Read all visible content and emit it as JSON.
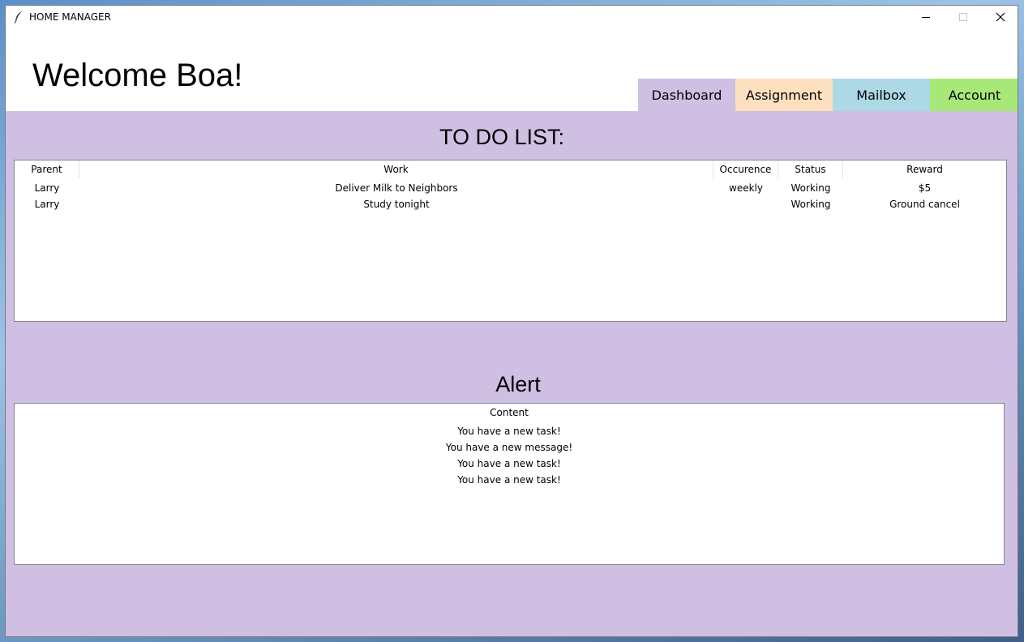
{
  "window": {
    "title": "HOME MANAGER"
  },
  "header": {
    "welcome": "Welcome Boa!"
  },
  "tabs": [
    {
      "label": "Dashboard",
      "color": "#cfbfe3"
    },
    {
      "label": "Assignment",
      "color": "#fde0c0"
    },
    {
      "label": "Mailbox",
      "color": "#add8e6"
    },
    {
      "label": "Account",
      "color": "#a8e878"
    }
  ],
  "todo": {
    "title": "TO DO LIST:",
    "columns": [
      "Parent",
      "Work",
      "Occurence",
      "Status",
      "Reward"
    ],
    "rows": [
      {
        "parent": "Larry",
        "work": "Deliver Milk to Neighbors",
        "occurence": "weekly",
        "status": "Working",
        "reward": "$5"
      },
      {
        "parent": "Larry",
        "work": "Study tonight",
        "occurence": "",
        "status": "Working",
        "reward": "Ground cancel"
      }
    ]
  },
  "alert": {
    "title": "Alert",
    "column": "Content",
    "rows": [
      "You have a new task!",
      "You have a new message!",
      "You have a new task!",
      "You have a new task!"
    ]
  },
  "colors": {
    "content_bg": "#cfbfe3"
  }
}
